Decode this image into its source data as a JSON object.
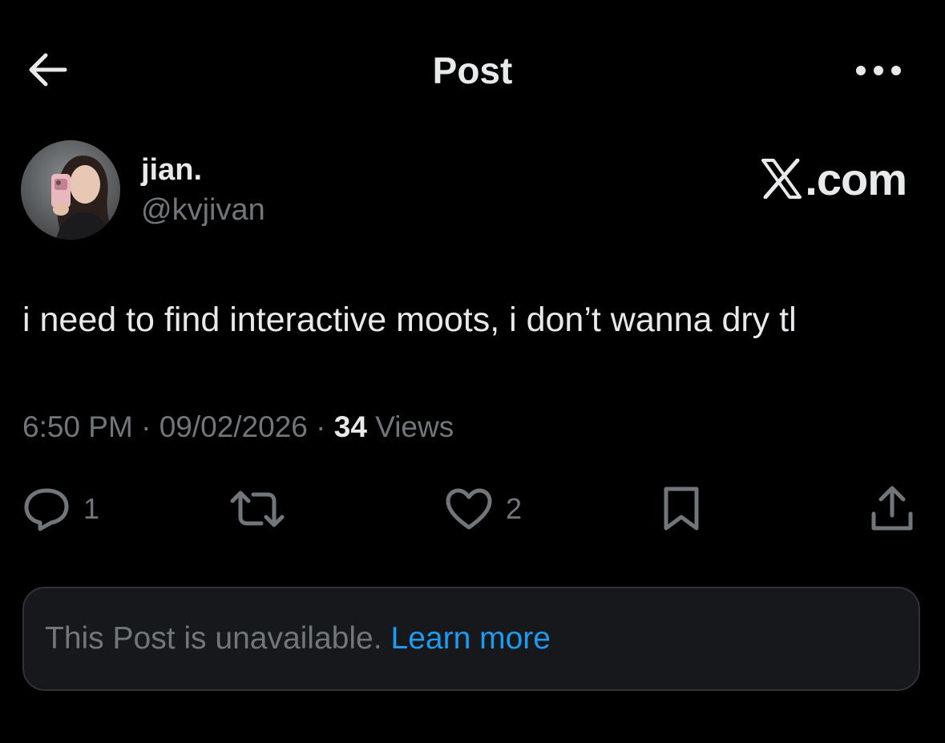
{
  "header": {
    "title": "Post",
    "back_icon": "arrow-left-icon",
    "more_icon": "more-dots-icon"
  },
  "author": {
    "display_name": "jian.",
    "handle": "@kvjivan",
    "avatar_icon": "avatar-photo"
  },
  "watermark": {
    "text": ".com",
    "icon": "x-logo-icon"
  },
  "post": {
    "text": "i need to find interactive moots, i don’t wanna dry tl"
  },
  "meta": {
    "time": "6:50 PM",
    "separator": "·",
    "date": "09/02/2026",
    "views_count": "34",
    "views_label": "Views"
  },
  "actions": {
    "reply": {
      "icon": "reply-icon",
      "count": "1"
    },
    "repost": {
      "icon": "repost-icon",
      "count": ""
    },
    "like": {
      "icon": "heart-icon",
      "count": "2"
    },
    "bookmark": {
      "icon": "bookmark-icon",
      "count": ""
    },
    "share": {
      "icon": "share-icon",
      "count": ""
    }
  },
  "notice": {
    "text": "This Post is unavailable.",
    "link_label": "Learn more"
  },
  "colors": {
    "background": "#000000",
    "primary_text": "#e7e9ea",
    "secondary_text": "#71767b",
    "link": "#1d9bf0",
    "notice_background": "#16181c",
    "notice_border": "#2f3336"
  }
}
